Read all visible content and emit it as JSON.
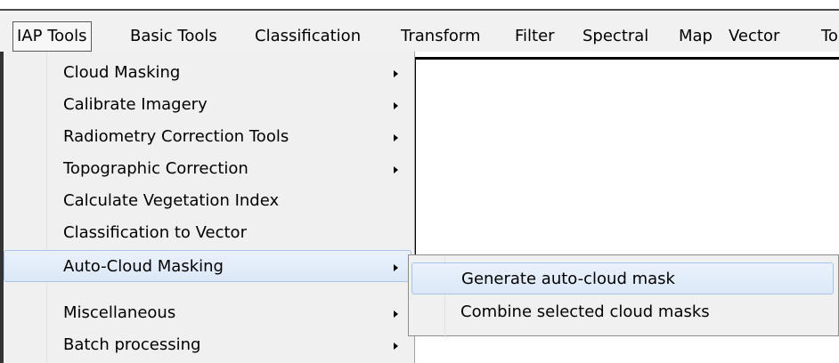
{
  "menubar": {
    "items": [
      {
        "label": "IAP Tools"
      },
      {
        "label": "Basic Tools"
      },
      {
        "label": "Classification"
      },
      {
        "label": "Transform"
      },
      {
        "label": "Filter"
      },
      {
        "label": "Spectral"
      },
      {
        "label": "Map"
      },
      {
        "label": "Vector"
      },
      {
        "label": "To"
      }
    ]
  },
  "dropdown": {
    "items": [
      {
        "label": "Cloud Masking"
      },
      {
        "label": "Calibrate Imagery"
      },
      {
        "label": "Radiometry Correction Tools"
      },
      {
        "label": "Topographic Correction"
      },
      {
        "label": "Calculate Vegetation Index"
      },
      {
        "label": "Classification to Vector"
      },
      {
        "label": "Auto-Cloud Masking"
      },
      {
        "label": "Miscellaneous"
      },
      {
        "label": "Batch processing"
      }
    ]
  },
  "submenu": {
    "items": [
      {
        "label": "Generate auto-cloud mask"
      },
      {
        "label": "Combine selected cloud masks"
      }
    ]
  },
  "colors": {
    "menu_bg": "#f0f0f0",
    "highlight_bg": "#dce8f8",
    "highlight_border": "#a8c4e8"
  }
}
